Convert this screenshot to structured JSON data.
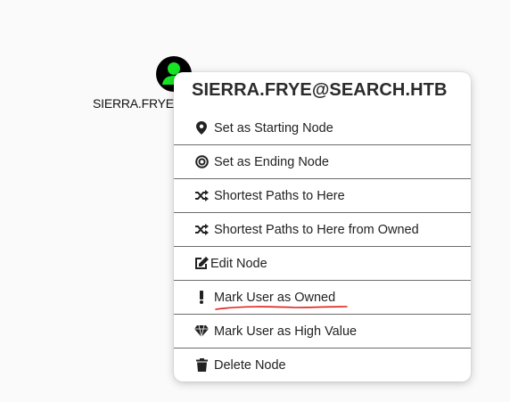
{
  "node": {
    "label": "SIERRA.FRYE@SEARCH.HTB",
    "icon": "user-icon",
    "color": "#17e625"
  },
  "menu": {
    "title": "SIERRA.FRYE@SEARCH.HTB",
    "items": [
      {
        "label": "Set as Starting Node",
        "icon": "map-marker-icon"
      },
      {
        "label": "Set as Ending Node",
        "icon": "bullseye-icon"
      },
      {
        "label": "Shortest Paths to Here",
        "icon": "random-icon"
      },
      {
        "label": "Shortest Paths to Here from Owned",
        "icon": "random-icon"
      },
      {
        "label": "Edit Node",
        "icon": "edit-icon"
      },
      {
        "label": "Mark User as Owned",
        "icon": "exclamation-icon"
      },
      {
        "label": "Mark User as High Value",
        "icon": "gem-icon"
      },
      {
        "label": "Delete Node",
        "icon": "trash-icon"
      }
    ]
  },
  "annotation_color": "#e0201c"
}
